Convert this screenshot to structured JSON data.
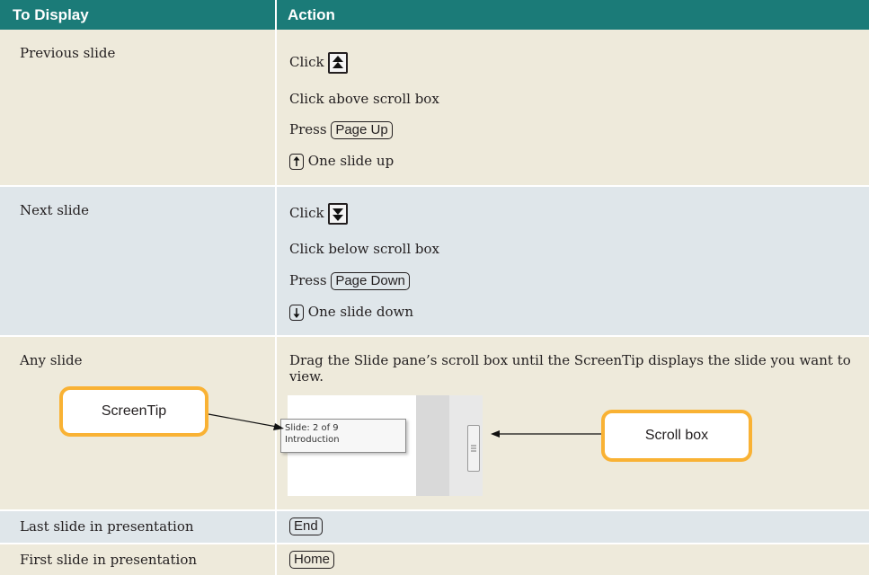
{
  "header": {
    "col1": "To Display",
    "col2": "Action"
  },
  "rows": {
    "prev": {
      "label": "Previous slide",
      "a1": "Click",
      "a2": "Click above scroll box",
      "a3": "Press",
      "a3_key": "Page Up",
      "a4": "One slide up"
    },
    "next": {
      "label": "Next slide",
      "a1": "Click",
      "a2": "Click below scroll box",
      "a3": "Press",
      "a3_key": "Page Down",
      "a4": "One slide down"
    },
    "any": {
      "label": "Any slide",
      "a1": "Drag the Slide pane’s scroll box until the ScreenTip displays the slide you want to view."
    },
    "last": {
      "label": "Last slide in presentation",
      "key": "End"
    },
    "first": {
      "label": "First slide in presentation",
      "key": "Home"
    }
  },
  "callouts": {
    "screentip": "ScreenTip",
    "scrollbox": "Scroll box"
  },
  "screenshot": {
    "tip_line1": "Slide: 2 of 9",
    "tip_line2": "Introduction"
  },
  "icons": {
    "prev_button": "double-up-arrow-icon",
    "next_button": "double-down-arrow-icon",
    "up_key": "up-arrow-key-icon",
    "down_key": "down-arrow-key-icon"
  },
  "colors": {
    "header": "#1b7b78",
    "beige": "#eeeadb",
    "blue": "#dfe6ea",
    "callout_border": "#f9b234"
  }
}
